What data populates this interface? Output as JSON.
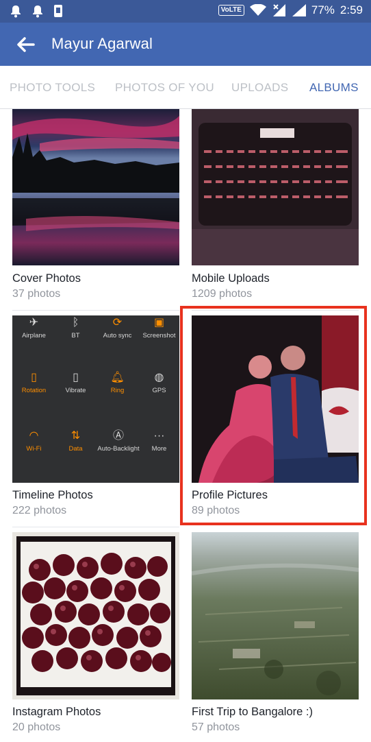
{
  "status_bar": {
    "volte": "VoLTE",
    "battery": "77%",
    "time": "2:59"
  },
  "header": {
    "title": "Mayur Agarwal"
  },
  "tabs": [
    {
      "label": "PHOTO TOOLS",
      "active": false
    },
    {
      "label": "PHOTOS OF YOU",
      "active": false
    },
    {
      "label": "UPLOADS",
      "active": false
    },
    {
      "label": "ALBUMS",
      "active": true
    }
  ],
  "albums": [
    {
      "name": "Cover Photos",
      "count": "37 photos"
    },
    {
      "name": "Mobile Uploads",
      "count": "1209 photos"
    },
    {
      "name": "Timeline Photos",
      "count": "222 photos"
    },
    {
      "name": "Profile Pictures",
      "count": "89 photos",
      "highlighted": true
    },
    {
      "name": "Instagram Photos",
      "count": "20 photos"
    },
    {
      "name": "First Trip to Bangalore :)",
      "count": "57 photos"
    }
  ],
  "quick_settings": [
    {
      "label": "Airplane",
      "icon": "airplane-icon"
    },
    {
      "label": "BT",
      "icon": "bluetooth-icon"
    },
    {
      "label": "Auto sync",
      "icon": "sync-icon"
    },
    {
      "label": "Screenshot",
      "icon": "screenshot-icon"
    },
    {
      "label": "Rotation",
      "icon": "rotation-icon"
    },
    {
      "label": "Vibrate",
      "icon": "vibrate-icon"
    },
    {
      "label": "Ring",
      "icon": "bell-icon"
    },
    {
      "label": "GPS",
      "icon": "gps-icon"
    },
    {
      "label": "Wi-Fi",
      "icon": "wifi-icon"
    },
    {
      "label": "Data",
      "icon": "data-icon"
    },
    {
      "label": "Auto-Backlight",
      "icon": "backlight-icon"
    },
    {
      "label": "More",
      "icon": "more-icon"
    }
  ],
  "colors": {
    "brand": "#4267b2",
    "highlight": "#e8321e",
    "quick_toggle_on": "#ff8f00"
  }
}
